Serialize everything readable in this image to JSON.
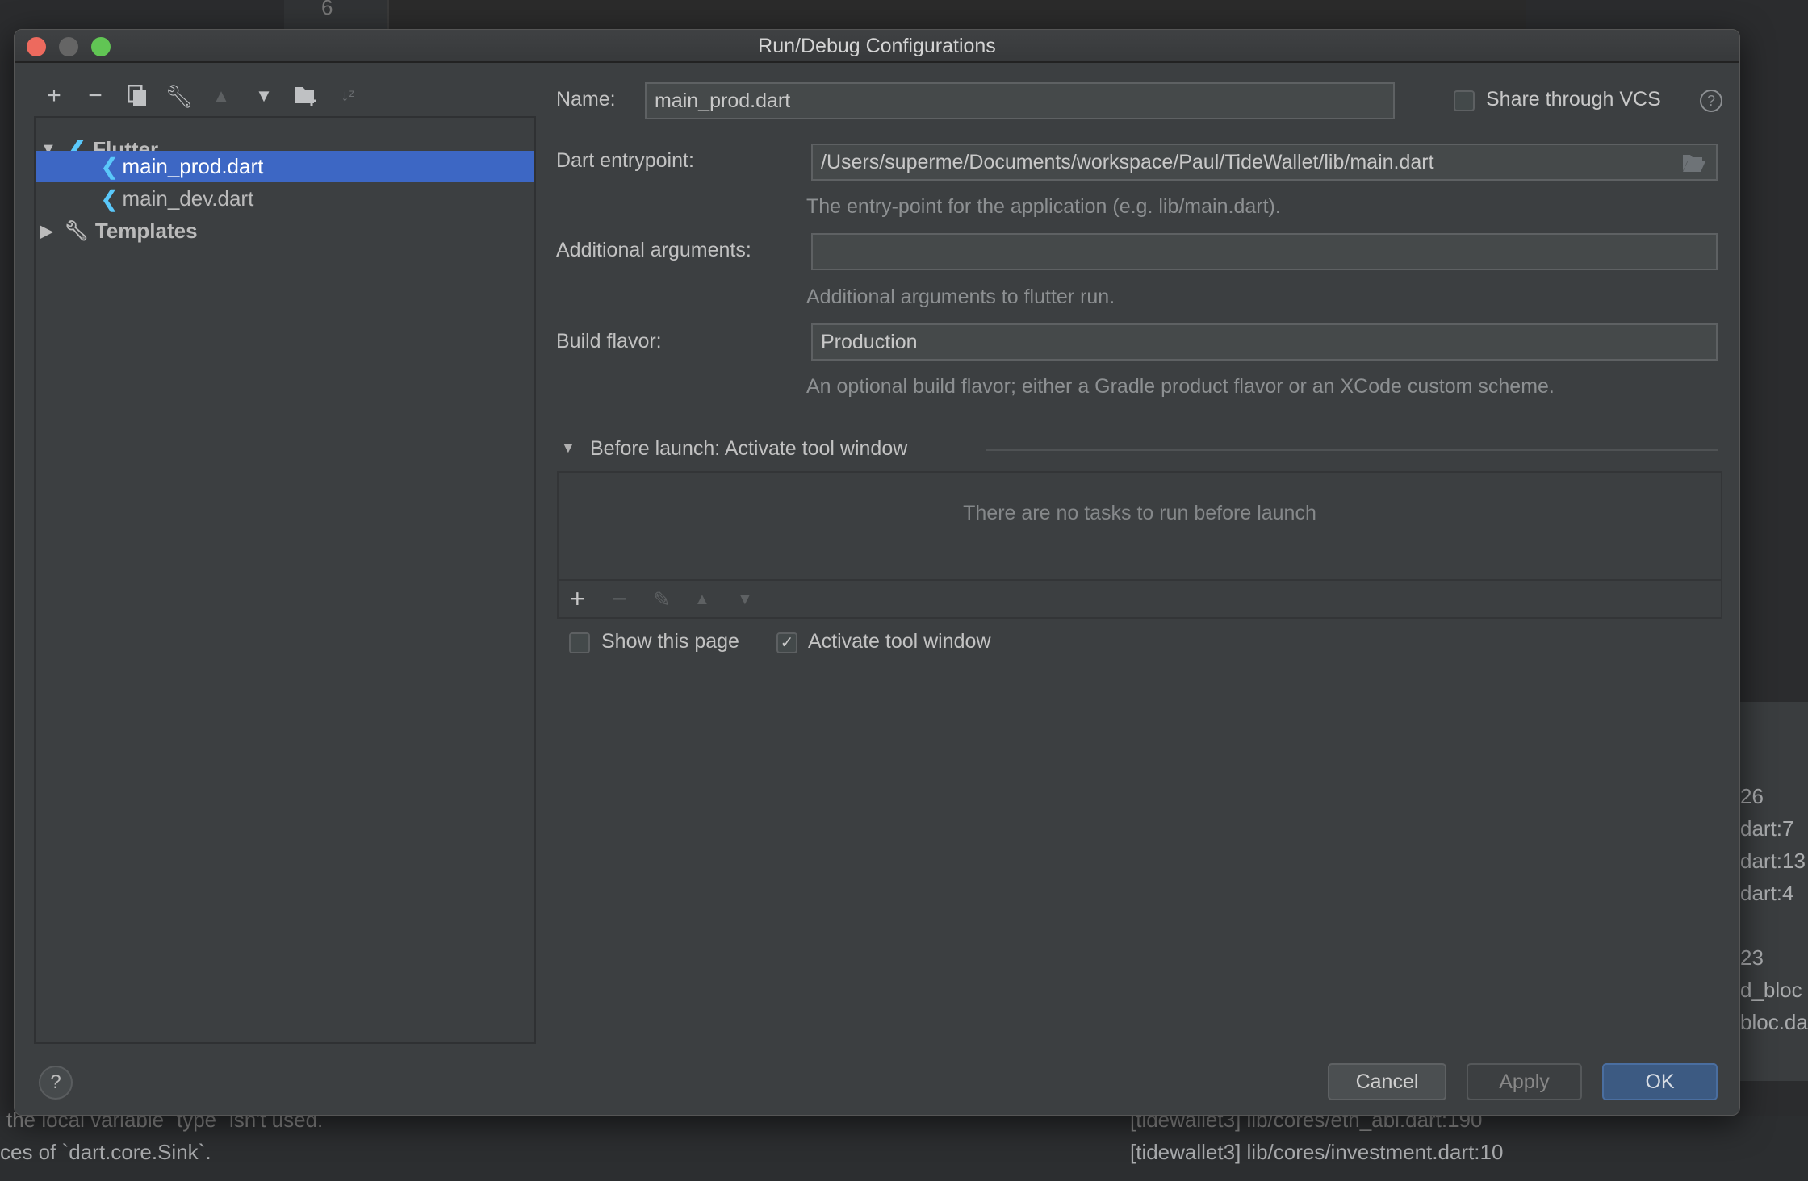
{
  "dialog": {
    "title": "Run/Debug Configurations",
    "toolbar_icons": [
      "plus-icon",
      "minus-icon",
      "copy-icon",
      "wrench-icon",
      "arrow-up-icon",
      "arrow-down-icon",
      "new-folder-icon",
      "sort-alpha-icon"
    ],
    "tree": {
      "group": "Flutter",
      "items": [
        {
          "label": "main_prod.dart",
          "selected": true
        },
        {
          "label": "main_dev.dart",
          "selected": false
        }
      ],
      "templates": "Templates"
    },
    "form": {
      "name_label": "Name:",
      "name_value": "main_prod.dart",
      "share_label": "Share through VCS",
      "share_checked": false,
      "entrypoint_label": "Dart entrypoint:",
      "entrypoint_value": "/Users/superme/Documents/workspace/Paul/TideWallet/lib/main.dart",
      "entrypoint_hint": "The entry-point for the application (e.g. lib/main.dart).",
      "args_label": "Additional arguments:",
      "args_value": "",
      "args_hint": "Additional arguments to flutter run.",
      "flavor_label": "Build flavor:",
      "flavor_value": "Production",
      "flavor_hint": "An optional build flavor; either a Gradle product flavor or an XCode custom scheme."
    },
    "before_launch": {
      "title": "Before launch: Activate tool window",
      "empty_text": "There are no tasks to run before launch",
      "show_page_label": "Show this page",
      "show_page_checked": false,
      "activate_label": "Activate tool window",
      "activate_checked": true
    },
    "buttons": {
      "help": "?",
      "cancel": "Cancel",
      "apply": "Apply",
      "ok": "OK"
    },
    "colors": {
      "selection": "#3d67c4",
      "ok_button": "#3c5a82",
      "background": "#3c3f41"
    }
  },
  "background": {
    "line_number": "6",
    "right_fragments": [
      "26",
      "dart:7",
      "dart:13",
      "dart:4",
      "23",
      "d_bloc",
      "bloc.da"
    ],
    "bottom_left": [
      "the local variable `type` isn't used.",
      "ces of `dart.core.Sink`."
    ],
    "bottom_right": [
      "[tidewallet3] lib/cores/eth_abi.dart:190",
      "[tidewallet3] lib/cores/investment.dart:10"
    ]
  }
}
